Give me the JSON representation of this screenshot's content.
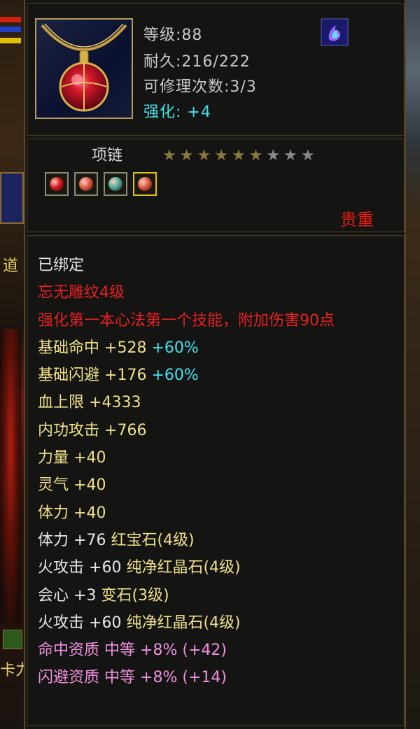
{
  "item": {
    "icon": "ruby-necklace-icon",
    "level": "等级:88",
    "durability": "耐久:216/222",
    "repair_count": "可修理次数:3/3",
    "enhance_label": "强化:",
    "enhance_value": "+4",
    "skill_icon": "purple-flame-skill-icon",
    "type": "项链",
    "stars": {
      "filled": 6,
      "total": 9
    },
    "sockets": [
      {
        "gem": "red-gem-icon",
        "color": "#d21a1a",
        "selected": false
      },
      {
        "gem": "orange-gem-icon",
        "color": "#e05a40",
        "selected": false
      },
      {
        "gem": "teal-gem-icon",
        "color": "#4ab09a",
        "selected": false
      },
      {
        "gem": "red-orange-gem-icon",
        "color": "#e05a40",
        "selected": true
      }
    ],
    "quality": "贵重"
  },
  "details": {
    "bound": "已绑定",
    "engrave_title": "忘无雕纹4级",
    "engrave_desc": "强化第一本心法第一个技能，附加伤害90点",
    "stats": [
      {
        "label": "基础命中",
        "value": "+528",
        "extra": "+60%"
      },
      {
        "label": "基础闪避",
        "value": "+176",
        "extra": "+60%"
      },
      {
        "label": "血上限",
        "value": "+4333",
        "extra": ""
      },
      {
        "label": "内功攻击",
        "value": "+766",
        "extra": ""
      },
      {
        "label": "力量",
        "value": "+40",
        "extra": ""
      },
      {
        "label": "灵气",
        "value": "+40",
        "extra": ""
      },
      {
        "label": "体力",
        "value": "+40",
        "extra": ""
      }
    ],
    "gem_stats": [
      {
        "label": "体力",
        "value": "+76",
        "gem": "红宝石(4级)"
      },
      {
        "label": "火攻击",
        "value": "+60",
        "gem": "纯净红晶石(4级)"
      },
      {
        "label": "会心",
        "value": "+3",
        "gem": "变石(3级)"
      },
      {
        "label": "火攻击",
        "value": "+60",
        "gem": "纯净红晶石(4级)"
      }
    ],
    "aptitudes": [
      {
        "label": "命中资质",
        "grade": "中等",
        "value": "+8%",
        "bonus": "(+42)"
      },
      {
        "label": "闪避资质",
        "grade": "中等",
        "value": "+8%",
        "bonus": "(+14)"
      }
    ]
  },
  "side": {
    "left_text_1": "道",
    "left_text_2": "卡力"
  },
  "colors": {
    "quality": "#e81c10",
    "enhance": "#3fe0e8",
    "engrave": "#e82020",
    "stat": "#f0e08a",
    "aptitude": "#f090e0",
    "star_filled": "#8a7a3a",
    "star_empty": "#8a8a8a"
  }
}
